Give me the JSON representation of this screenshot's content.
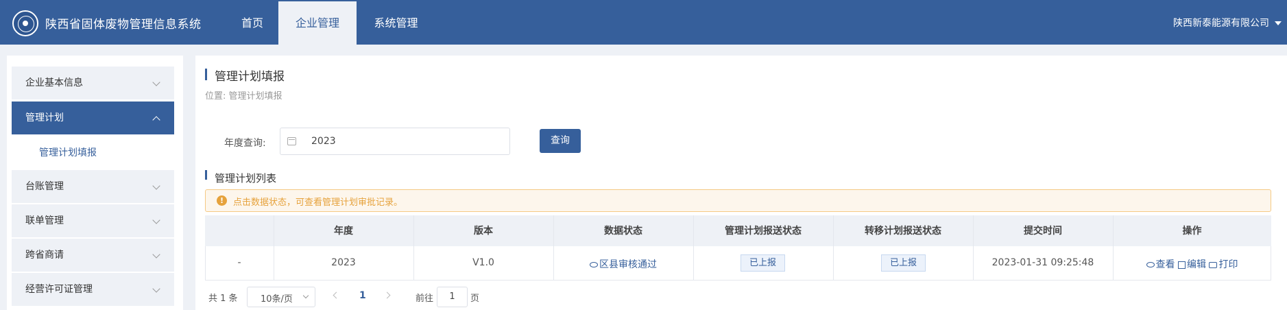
{
  "app": {
    "title": "陕西省固体废物管理信息系统",
    "company": "陕西新泰能源有限公司"
  },
  "nav": {
    "tabs": [
      {
        "label": "首页"
      },
      {
        "label": "企业管理"
      },
      {
        "label": "系统管理"
      }
    ]
  },
  "sidebar": {
    "items": [
      {
        "label": "企业基本信息"
      },
      {
        "label": "管理计划"
      },
      {
        "label": "台账管理"
      },
      {
        "label": "联单管理"
      },
      {
        "label": "跨省商请"
      },
      {
        "label": "经营许可证管理"
      }
    ],
    "sub_item": "管理计划填报"
  },
  "page": {
    "title": "管理计划填报",
    "location": "位置: 管理计划填报"
  },
  "filter": {
    "year_label": "年度查询:",
    "year_value": "2023",
    "query_button": "查询"
  },
  "list": {
    "title": "管理计划列表",
    "alert": "点击数据状态，可查看管理计划审批记录。",
    "alert_icon": "!",
    "headers": [
      "年度",
      "版本",
      "数据状态",
      "管理计划报送状态",
      "转移计划报送状态",
      "提交时间",
      "操作"
    ],
    "rows": [
      {
        "index": "-",
        "year": "2023",
        "version": "V1.0",
        "data_status": "区县审核通过",
        "plan_status": "已上报",
        "transfer_status": "已上报",
        "submit_time": "2023-01-31 09:25:48",
        "actions": {
          "view": "查看",
          "edit": "编辑",
          "print": "打印"
        }
      }
    ]
  },
  "pagination": {
    "total": "共 1 条",
    "page_size": "10条/页",
    "current": "1",
    "goto_label": "前往",
    "goto_value": "1",
    "page_label": "页"
  },
  "colors": {
    "primary": "#365f9b",
    "warning": "#e6a23c",
    "background": "#eef1f6"
  }
}
